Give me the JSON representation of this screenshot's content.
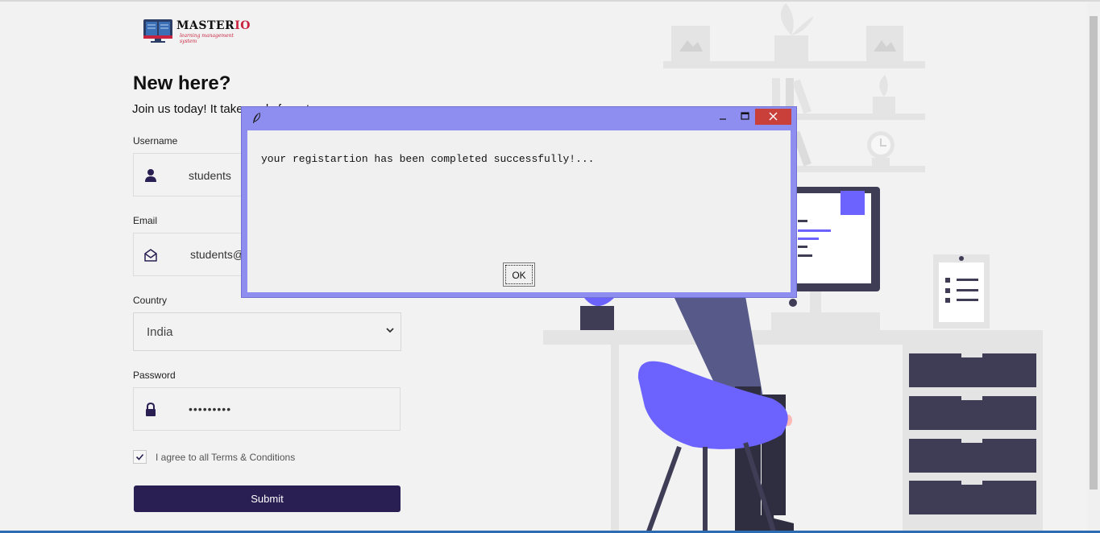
{
  "brand": {
    "name_main": "MASTER",
    "name_accent": "IO",
    "tagline": "learning management system"
  },
  "form": {
    "heading": "New here?",
    "subheading": "Join us today! It takes only few steps",
    "username": {
      "label": "Username",
      "value": "students",
      "icon": "user-icon"
    },
    "email": {
      "label": "Email",
      "value": "students@gmail.com",
      "icon": "envelope-icon"
    },
    "country": {
      "label": "Country",
      "value": "India",
      "icon": "chevron-down-icon"
    },
    "password": {
      "label": "Password",
      "value": "•••••••••",
      "icon": "lock-icon"
    },
    "terms": {
      "label": "I agree to all Terms & Conditions",
      "checked": true
    },
    "submit_label": "Submit"
  },
  "dialog": {
    "message": "your registartion has been completed successfully!...",
    "ok_label": "OK",
    "titlebar_color": "#8e8ef0",
    "close_color": "#c9403a"
  },
  "colors": {
    "accent": "#2a1f52",
    "illustration_purple": "#6c63ff",
    "illustration_dark": "#3f3d56"
  }
}
